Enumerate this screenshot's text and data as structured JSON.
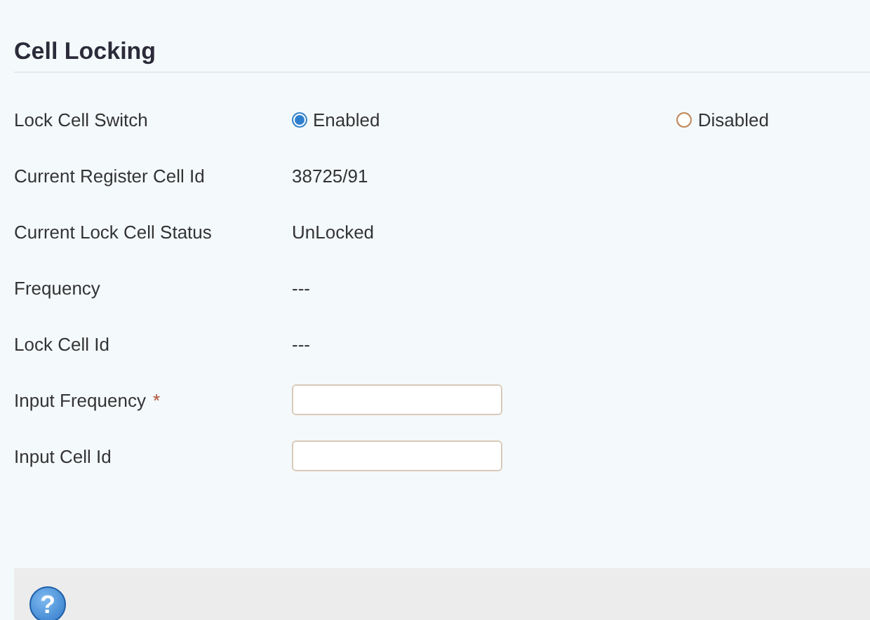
{
  "title": "Cell Locking",
  "rows": [
    {
      "kind": "radio",
      "label": "Lock Cell Switch",
      "options": [
        {
          "label": "Enabled",
          "selected": true
        },
        {
          "label": "Disabled",
          "selected": false
        }
      ]
    },
    {
      "kind": "text",
      "label": "Current Register Cell Id",
      "value": "38725/91"
    },
    {
      "kind": "text",
      "label": "Current Lock Cell Status",
      "value": "UnLocked"
    },
    {
      "kind": "text",
      "label": "Frequency",
      "value": "---"
    },
    {
      "kind": "text",
      "label": "Lock Cell Id",
      "value": "---"
    },
    {
      "kind": "input",
      "label": "Input Frequency",
      "required_mark": "*"
    },
    {
      "kind": "input",
      "label": "Input Cell Id"
    }
  ],
  "help": {
    "icon": "?"
  }
}
